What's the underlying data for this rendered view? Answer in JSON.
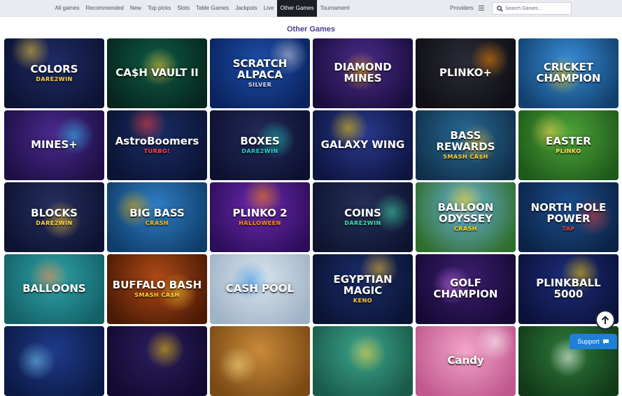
{
  "nav": {
    "items": [
      {
        "label": "All games",
        "active": false
      },
      {
        "label": "Recommended",
        "active": false
      },
      {
        "label": "New",
        "active": false
      },
      {
        "label": "Top picks",
        "active": false
      },
      {
        "label": "Slots",
        "active": false
      },
      {
        "label": "Table Games",
        "active": false
      },
      {
        "label": "Jackpots",
        "active": false
      },
      {
        "label": "Live",
        "active": false
      },
      {
        "label": "Other Games",
        "active": true
      },
      {
        "label": "Tournament",
        "active": false
      }
    ],
    "providers_label": "Providers",
    "menu_icon": "hamburger-icon"
  },
  "search": {
    "placeholder": "Search Games...",
    "value": "",
    "icon": "search-icon"
  },
  "page_title": "Other Games",
  "games": [
    {
      "title": "COLORS",
      "subtitle": "DARE2WIN",
      "bg": "#1f2c66",
      "bg2": "#0c1333",
      "accent": "#ffd23f"
    },
    {
      "title": "CA$H VAULT II",
      "subtitle": "",
      "bg": "#0f5a45",
      "bg2": "#06261d",
      "accent": "#ffcc33"
    },
    {
      "title": "SCRATCH ALPACA",
      "subtitle": "SILVER",
      "bg": "#1d4fa8",
      "bg2": "#0a2360",
      "accent": "#d8d8e8"
    },
    {
      "title": "DIAMOND MINES",
      "subtitle": "",
      "bg": "#4a2c8a",
      "bg2": "#1a0d3d",
      "accent": "#ffb400"
    },
    {
      "title": "PLINKO+",
      "subtitle": "",
      "bg": "#2c2c38",
      "bg2": "#0e0e14",
      "accent": "#ff8a00"
    },
    {
      "title": "CRICKET CHAMPION",
      "subtitle": "",
      "bg": "#3a8ed8",
      "bg2": "#11406e",
      "accent": "#ffcc00"
    },
    {
      "title": "MINES+",
      "subtitle": "",
      "bg": "#4a2a8e",
      "bg2": "#1d0f45",
      "accent": "#35c6ff"
    },
    {
      "title": "AstroBoomers",
      "subtitle": "TURBO!",
      "bg": "#1a2e66",
      "bg2": "#0a1333",
      "accent": "#ff3e3e"
    },
    {
      "title": "BOXES",
      "subtitle": "DARE2WIN",
      "bg": "#242a58",
      "bg2": "#0d1030",
      "accent": "#21d3c4"
    },
    {
      "title": "GALAXY WING",
      "subtitle": "",
      "bg": "#2a3a8e",
      "bg2": "#0d1540",
      "accent": "#ffd400"
    },
    {
      "title": "BASS REWARDS",
      "subtitle": "SMASH CA$H",
      "bg": "#2a6a96",
      "bg2": "#10304a",
      "accent": "#ffcc33"
    },
    {
      "title": "EASTER",
      "subtitle": "PLINKO",
      "bg": "#4ea53a",
      "bg2": "#1e5a1a",
      "accent": "#ffdd55"
    },
    {
      "title": "BLOCKS",
      "subtitle": "DARE2WIN",
      "bg": "#26305e",
      "bg2": "#0d1231",
      "accent": "#ffd23f"
    },
    {
      "title": "BIG BASS",
      "subtitle": "CRASH",
      "bg": "#2f7ec4",
      "bg2": "#0f3d6a",
      "accent": "#ffb800"
    },
    {
      "title": "PLINKO 2",
      "subtitle": "HALLOWEEN",
      "bg": "#6d2ab0",
      "bg2": "#2c0d5a",
      "accent": "#ff8a00"
    },
    {
      "title": "COINS",
      "subtitle": "DARE2WIN",
      "bg": "#253058",
      "bg2": "#0e1430",
      "accent": "#3ee0a8"
    },
    {
      "title": "BALLOON ODYSSEY",
      "subtitle": "CRASH",
      "bg": "#6bb4e0",
      "bg2": "#2f6e2a",
      "accent": "#ffd400"
    },
    {
      "title": "NORTH POLE POWER",
      "subtitle": "TAP",
      "bg": "#1c4f8e",
      "bg2": "#0b2346",
      "accent": "#e23a3a"
    },
    {
      "title": "BALLOONS",
      "subtitle": "",
      "bg": "#2fa3a8",
      "bg2": "#136066",
      "accent": "#ff8844"
    },
    {
      "title": "BUFFALO BASH",
      "subtitle": "SMASH CA$H",
      "bg": "#b04a16",
      "bg2": "#4a1a05",
      "accent": "#ffcc33"
    },
    {
      "title": "CASH POOL",
      "subtitle": "",
      "bg": "#d8e4ef",
      "bg2": "#9fb3c6",
      "accent": "#2b8fe0"
    },
    {
      "title": "EGYPTIAN MAGIC",
      "subtitle": "KENO",
      "bg": "#1a2d6a",
      "bg2": "#0a1433",
      "accent": "#ffc533"
    },
    {
      "title": "GOLF CHAMPION",
      "subtitle": "",
      "bg": "#3c1f70",
      "bg2": "#160935",
      "accent": "#d87cff"
    },
    {
      "title": "PLINKBALL 5000",
      "subtitle": "",
      "bg": "#1d2d7a",
      "bg2": "#0a123a",
      "accent": "#ffd400"
    },
    {
      "title": "",
      "subtitle": "",
      "bg": "#1e3a8a",
      "bg2": "#0b1a45",
      "accent": "#7ad4ff"
    },
    {
      "title": "",
      "subtitle": "",
      "bg": "#2a1e5e",
      "bg2": "#120a30",
      "accent": "#ffcc00"
    },
    {
      "title": "",
      "subtitle": "",
      "bg": "#c98a3a",
      "bg2": "#7a4a14",
      "accent": "#ffe08a"
    },
    {
      "title": "",
      "subtitle": "",
      "bg": "#3ba58c",
      "bg2": "#1a5a4a",
      "accent": "#ffd23f"
    },
    {
      "title": "Candy",
      "subtitle": "",
      "bg": "#f2a4c8",
      "bg2": "#c0588e",
      "accent": "#ffffff"
    },
    {
      "title": "",
      "subtitle": "",
      "bg": "#2e7a3a",
      "bg2": "#123a18",
      "accent": "#ffffff"
    }
  ],
  "scroll_top": {
    "icon": "arrow-up-icon"
  },
  "support": {
    "label": "Support",
    "icon": "chat-icon"
  }
}
